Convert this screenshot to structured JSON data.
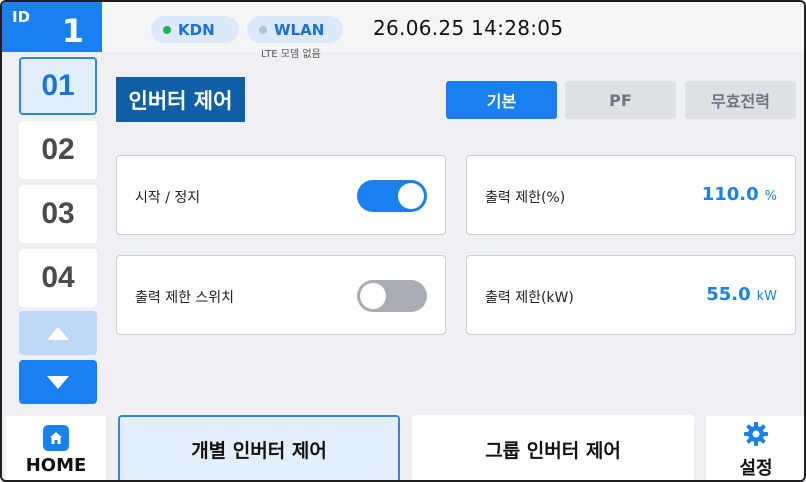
{
  "header": {
    "id_label": "ID",
    "id_value": "1",
    "status_kdn": "KDN",
    "status_wlan": "WLAN",
    "lte_note": "LTE 모뎀 없음",
    "datetime": "26.06.25  14:28:05"
  },
  "id_list": [
    "01",
    "02",
    "03",
    "04"
  ],
  "page": {
    "title": "인버터 제어",
    "tabs": {
      "basic": "기본",
      "pf": "PF",
      "reactive": "무효전력"
    }
  },
  "controls": {
    "start_stop": {
      "label": "시작 / 정지",
      "state": "on"
    },
    "limit_switch": {
      "label": "출력 제한 스위치",
      "state": "off"
    },
    "limit_percent": {
      "label": "출력 제한(%)",
      "value": "110.0",
      "unit": "%"
    },
    "limit_kw": {
      "label": "출력 제한(kW)",
      "value": "55.0",
      "unit": "kW"
    }
  },
  "bottom_nav": {
    "home": "HOME",
    "individual": "개별 인버터 제어",
    "group": "그룹 인버터 제어",
    "settings": "설정"
  },
  "colors": {
    "accent": "#1a7fef",
    "title_bg": "#0f5fa6",
    "status_online": "#1fb34a",
    "status_offline": "#b9c1cc"
  },
  "icons": [
    "home-icon",
    "gear-icon",
    "arrow-up-icon",
    "arrow-down-icon"
  ]
}
